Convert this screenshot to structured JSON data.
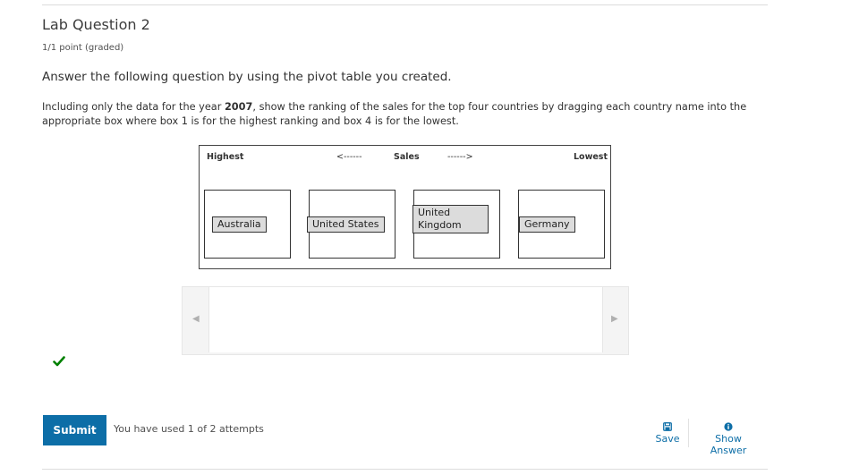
{
  "problem": {
    "title": "Lab Question 2",
    "points": "1/1 point (graded)",
    "prompt": "Answer the following question by using the pivot table you created.",
    "description": {
      "before": "Including only the data for the year ",
      "year": "2007",
      "after": ", show the ranking of the sales for the top four countries by dragging each country name into the appropriate box where box 1 is for the highest ranking and box 4 is for the lowest."
    }
  },
  "board": {
    "label_highest": "Highest",
    "arrow_left": "<------",
    "label_sales": "Sales",
    "arrow_right": "------>",
    "label_lowest": "Lowest",
    "items": [
      "Australia",
      "United States",
      "United Kingdom",
      "Germany"
    ]
  },
  "status": {
    "correct": true,
    "icon": "checkmark-icon",
    "color": "#008000"
  },
  "footer": {
    "submit_label": "Submit",
    "attempts_text": "You have used 1 of 2 attempts",
    "save_label": "Save",
    "show_answer_label": "Show Answer",
    "accent_color": "#0d6ea7"
  }
}
